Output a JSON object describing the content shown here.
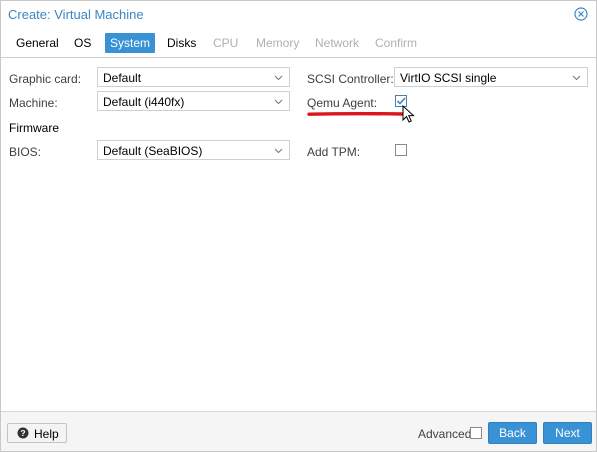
{
  "window": {
    "title": "Create: Virtual Machine",
    "close_icon": "close-circle-icon"
  },
  "tabs": [
    {
      "label": "General",
      "state": "normal"
    },
    {
      "label": "OS",
      "state": "normal"
    },
    {
      "label": "System",
      "state": "active"
    },
    {
      "label": "Disks",
      "state": "normal"
    },
    {
      "label": "CPU",
      "state": "disabled"
    },
    {
      "label": "Memory",
      "state": "disabled"
    },
    {
      "label": "Network",
      "state": "disabled"
    },
    {
      "label": "Confirm",
      "state": "disabled"
    }
  ],
  "form": {
    "graphic_card": {
      "label": "Graphic card:",
      "value": "Default"
    },
    "machine": {
      "label": "Machine:",
      "value": "Default (i440fx)"
    },
    "firmware_heading": "Firmware",
    "bios": {
      "label": "BIOS:",
      "value": "Default (SeaBIOS)"
    },
    "scsi_controller": {
      "label": "SCSI Controller:",
      "value": "VirtIO SCSI single"
    },
    "qemu_agent": {
      "label": "Qemu Agent:",
      "checked": true
    },
    "add_tpm": {
      "label": "Add TPM:",
      "checked": false
    }
  },
  "footer": {
    "help_label": "Help",
    "advanced_label": "Advanced",
    "advanced_checked": false,
    "back_label": "Back",
    "next_label": "Next"
  },
  "colors": {
    "accent": "#3892d4",
    "title": "#3d86c6",
    "annotation": "#d9161b"
  }
}
